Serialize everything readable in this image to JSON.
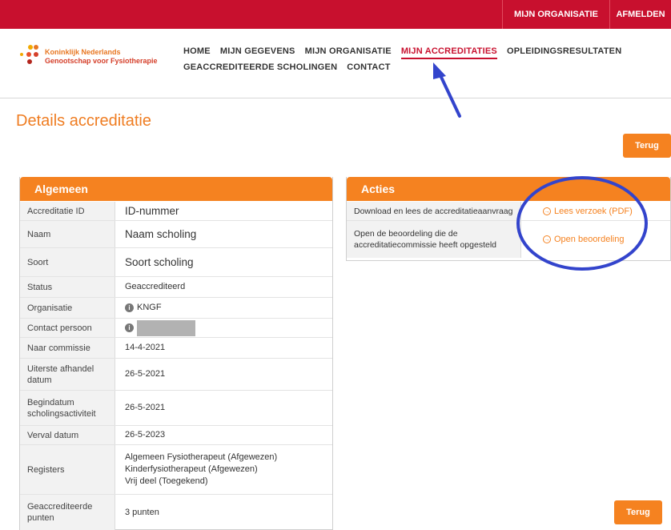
{
  "topbar": {
    "org_link": "MIJN ORGANISATIE",
    "logout_link": "AFMELDEN"
  },
  "logo": {
    "line1": "Koninklijk Nederlands",
    "line2": "Genootschap voor Fysiotherapie"
  },
  "nav": {
    "row1": [
      "HOME",
      "MIJN GEGEVENS",
      "MIJN ORGANISATIE",
      "MIJN ACCREDITATIES",
      "OPLEIDINGSRESULTATEN"
    ],
    "row2": [
      "GEACCREDITEERDE SCHOLINGEN",
      "CONTACT"
    ],
    "active": "MIJN ACCREDITATIES"
  },
  "page": {
    "title": "Details accreditatie",
    "back_label": "Terug"
  },
  "general": {
    "header": "Algemeen",
    "rows": [
      {
        "label": "Accreditatie ID",
        "value": "ID-nummer"
      },
      {
        "label": "Naam",
        "value": "Naam scholing"
      },
      {
        "label": "Soort",
        "value": "Soort scholing"
      },
      {
        "label": "Status",
        "value": "Geaccrediteerd"
      },
      {
        "label": "Organisatie",
        "value": "KNGF"
      },
      {
        "label": "Contact persoon",
        "value": ""
      },
      {
        "label": "Naar commissie",
        "value": "14-4-2021"
      },
      {
        "label": "Uiterste afhandel datum",
        "value": "26-5-2021"
      },
      {
        "label": "Begindatum scholingsactiviteit",
        "value": "26-5-2021"
      },
      {
        "label": "Verval datum",
        "value": "26-5-2023"
      },
      {
        "label": "Registers",
        "value_lines": [
          "Algemeen Fysiotherapeut (Afgewezen)",
          "Kinderfysiotherapeut (Afgewezen)",
          "Vrij deel (Toegekend)"
        ]
      },
      {
        "label": "Geaccrediteerde punten",
        "value": "3 punten"
      }
    ]
  },
  "actions": {
    "header": "Acties",
    "rows": [
      {
        "label": "Download en lees de accreditatieaanvraag",
        "link": "Lees verzoek (PDF)"
      },
      {
        "label": "Open de beoordeling die de accreditatiecommissie heeft opgesteld",
        "link": "Open beoordeling"
      }
    ]
  },
  "colors": {
    "brand_red": "#c8102e",
    "accent_orange": "#f58220",
    "annotation_blue": "#3344cc"
  }
}
